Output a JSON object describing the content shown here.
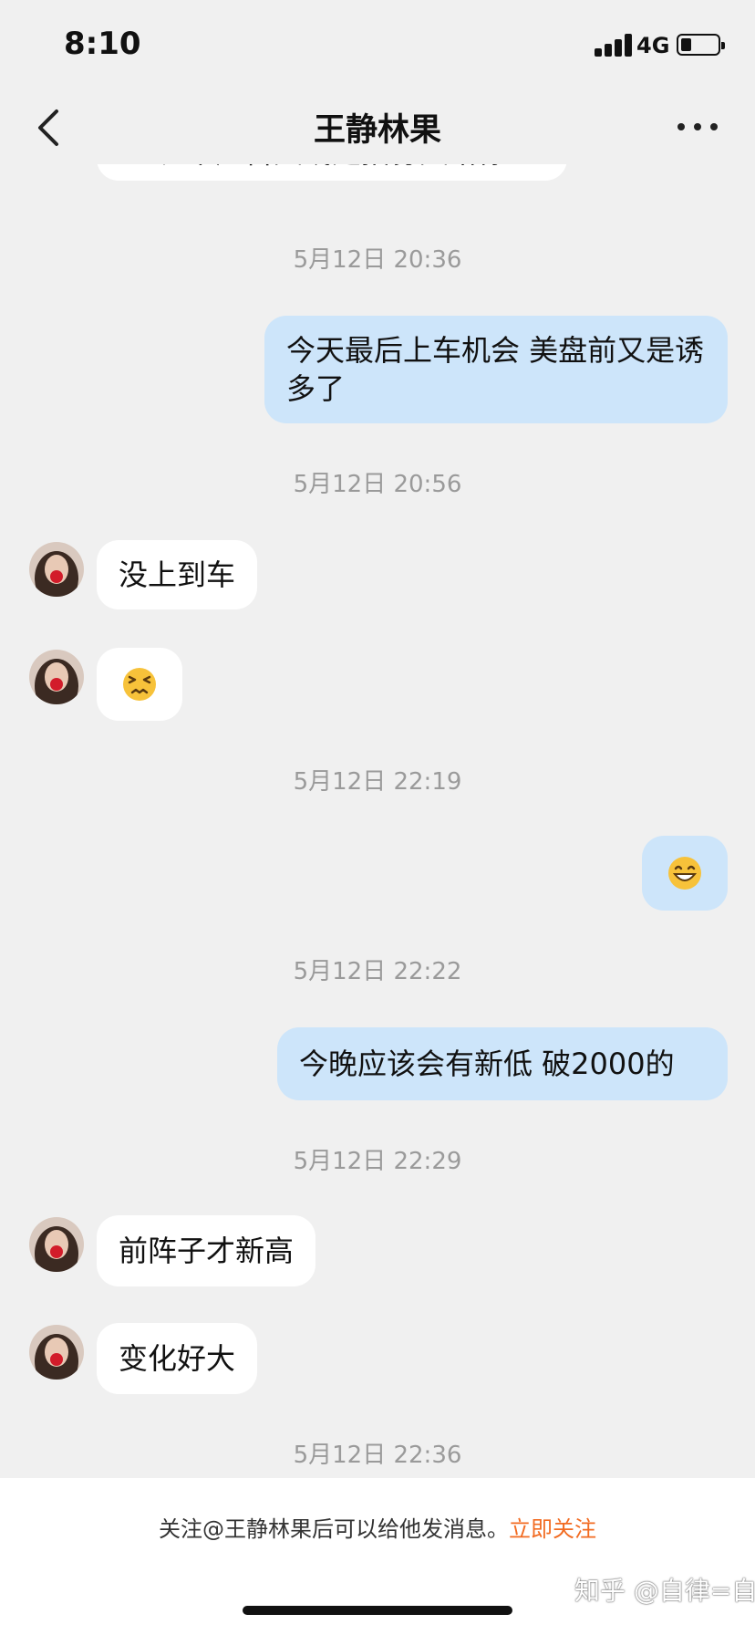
{
  "status_bar": {
    "time": "8:10",
    "network": "4G"
  },
  "nav": {
    "title": "王静林果",
    "back_icon": "chevron-left-icon",
    "more_icon": "more-dots-icon"
  },
  "chat": {
    "partial_message": "长中广告文或是招募文给你",
    "timestamps": [
      "5月12日 20:36",
      "5月12日 20:56",
      "5月12日 22:19",
      "5月12日 22:22",
      "5月12日 22:29",
      "5月12日 22:36"
    ],
    "messages": [
      {
        "side": "out",
        "text": "今天最后上车机会 美盘前又是诱多了"
      },
      {
        "side": "in",
        "text": "没上到车"
      },
      {
        "side": "in",
        "emoji": "persevering-face"
      },
      {
        "side": "out",
        "emoji": "grinning-face"
      },
      {
        "side": "out",
        "text": "今晚应该会有新低 破2000的"
      },
      {
        "side": "in",
        "text": "前阵子才新高"
      },
      {
        "side": "in",
        "text": "变化好大"
      }
    ]
  },
  "bottom": {
    "note": "关注@王静林果后可以给他发消息。",
    "follow_link": "立即关注",
    "watermark": "知乎 @自律=自由"
  },
  "colors": {
    "background": "#f0f0f0",
    "incoming_bubble": "#ffffff",
    "outgoing_bubble": "#cde5fa",
    "link": "#f26b21",
    "timestamp": "#9a9a9a"
  }
}
